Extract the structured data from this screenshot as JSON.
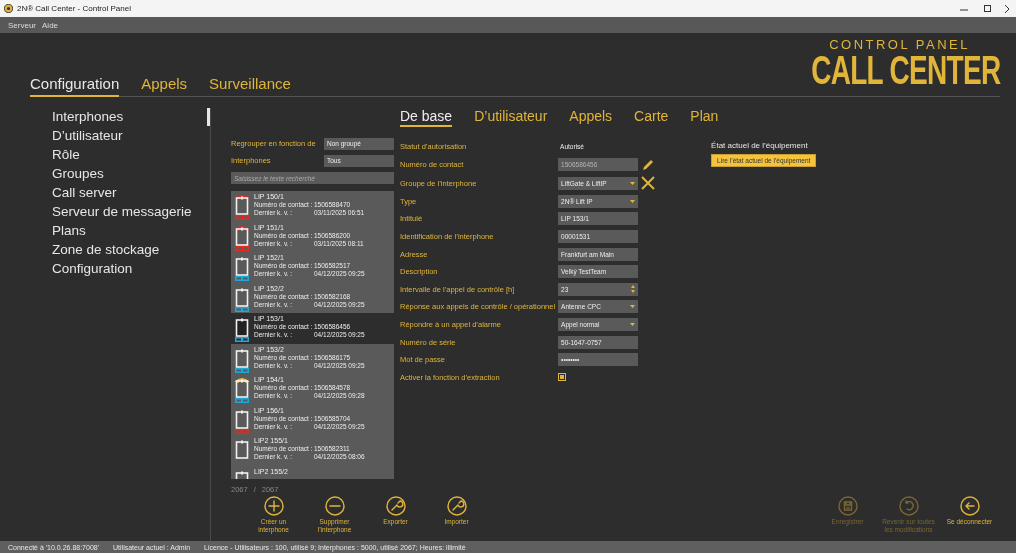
{
  "window": {
    "title": "2N® Call Center - Control Panel"
  },
  "menu": [
    "Serveur",
    "Aide"
  ],
  "logo": {
    "top": "CONTROL PANEL",
    "bottom": "CALL CENTER"
  },
  "main_tabs": [
    {
      "label": "Configuration",
      "selected": true
    },
    {
      "label": "Appels",
      "selected": false
    },
    {
      "label": "Surveillance",
      "selected": false
    }
  ],
  "sidebar": {
    "items": [
      {
        "label": "Interphones",
        "selected": true
      },
      {
        "label": "D’utilisateur",
        "selected": false
      },
      {
        "label": "Rôle",
        "selected": false
      },
      {
        "label": "Groupes",
        "selected": false
      },
      {
        "label": "Call server",
        "selected": false
      },
      {
        "label": "Serveur de messagerie",
        "selected": false
      },
      {
        "label": "Plans",
        "selected": false
      },
      {
        "label": "Zone de stockage",
        "selected": false
      },
      {
        "label": "Configuration",
        "selected": false
      }
    ]
  },
  "filters": [
    {
      "label": "Regrouper en fonction de",
      "value": "Non groupé"
    },
    {
      "label": "Interphones",
      "value": "Tous"
    }
  ],
  "search": {
    "placeholder": "Saisissez le texte recherché"
  },
  "intercoms": [
    {
      "name": "LIP 150/1",
      "contact_label": "Numéro de contact :",
      "contact": "1506588470",
      "last_label": "Dernier k. v. :",
      "last": "03/11/2025 06:51",
      "selected": false,
      "call": {
        "color": "#e8281e"
      },
      "link": {
        "color": "#e8281e"
      }
    },
    {
      "name": "LIP 151/1",
      "contact_label": "Numéro de contact :",
      "contact": "1506586200",
      "last_label": "Dernier k. v. :",
      "last": "03/11/2025 08:11",
      "selected": false,
      "call": {
        "color": "#e8281e"
      },
      "link": {
        "color": "#e8281e"
      }
    },
    {
      "name": "LIP 152/1",
      "contact_label": "Numéro de contact :",
      "contact": "1506582517",
      "last_label": "Dernier k. v. :",
      "last": "04/12/2025 09:25",
      "selected": false,
      "link": {
        "color": "#1ea8d8"
      }
    },
    {
      "name": "LIP 152/2",
      "contact_label": "Numéro de contact :",
      "contact": "1506582168",
      "last_label": "Dernier k. v. :",
      "last": "04/12/2025 09:25",
      "selected": false,
      "link": {
        "color": "#1ea8d8"
      }
    },
    {
      "name": "LIP 153/1",
      "contact_label": "Numéro de contact :",
      "contact": "1506586456",
      "last_label": "Dernier k. v. :",
      "last": "04/12/2025 09:25",
      "selected": true,
      "link": {
        "color": "#1ea8d8"
      }
    },
    {
      "name": "LIP 153/2",
      "contact_label": "Numéro de contact :",
      "contact": "1506586175",
      "last_label": "Dernier k. v. :",
      "last": "04/12/2025 09:25",
      "selected": false,
      "link": {
        "color": "#1ea8d8"
      }
    },
    {
      "name": "LIP 154/1",
      "contact_label": "Numéro de contact :",
      "contact": "1506584578",
      "last_label": "Dernier k. v. :",
      "last": "04/12/2025 09:28",
      "selected": false,
      "call": {
        "color": "#f0c030"
      },
      "link": {
        "color": "#1ea8d8"
      }
    },
    {
      "name": "LIP 156/1",
      "contact_label": "Numéro de contact :",
      "contact": "1506585704",
      "last_label": "Dernier k. v. :",
      "last": "04/12/2025 09:25",
      "selected": false,
      "link": {
        "color": "#e8281e"
      }
    },
    {
      "name": "LIP2 155/1",
      "contact_label": "Numéro de contact :",
      "contact": "1506582311",
      "last_label": "Dernier k. v. :",
      "last": "04/12/2025 08:06",
      "selected": false
    },
    {
      "name": "LIP2 155/2",
      "selected": false
    }
  ],
  "counter": {
    "shown": "2067",
    "separator": "/",
    "total": "2067"
  },
  "detail_tabs": [
    {
      "label": "De base",
      "selected": true
    },
    {
      "label": "D’utilisateur",
      "selected": false
    },
    {
      "label": "Appels",
      "selected": false
    },
    {
      "label": "Carte",
      "selected": false
    },
    {
      "label": "Plan",
      "selected": false
    }
  ],
  "form": [
    {
      "kind": "text",
      "label": "Statut d’autorisation",
      "value": "Autorisé"
    },
    {
      "kind": "locked",
      "label": "Numéro de contact",
      "value": "1506586456"
    },
    {
      "kind": "clearable",
      "label": "Groupe de l’interphone",
      "value": "LiftGate & LiftIP"
    },
    {
      "kind": "select",
      "label": "Type",
      "value": "2N® Lift IP"
    },
    {
      "kind": "input",
      "label": "Intitulé",
      "value": "LIP 153/1"
    },
    {
      "kind": "input",
      "label": "Identification de l’interphone",
      "value": "00001531"
    },
    {
      "kind": "input",
      "label": "Adresse",
      "value": "Frankfurt am Main"
    },
    {
      "kind": "input",
      "label": "Description",
      "value": "Velký TestTeam"
    },
    {
      "kind": "spinner",
      "label": "Intervalle de l’appel de contrôle [h]",
      "value": "23"
    },
    {
      "kind": "select",
      "label": "Réponse aux appels de contrôle / opérationnel",
      "value": "Antenne CPC"
    },
    {
      "kind": "select",
      "label": "Répondre à un appel d’alarme",
      "value": "Appel normal"
    },
    {
      "kind": "input",
      "label": "Numéro de série",
      "value": "50-1647-0757"
    },
    {
      "kind": "input",
      "label": "Mot de passe",
      "value": "••••••••"
    },
    {
      "kind": "checkbox",
      "label": "Activer la fonction d’extraction",
      "checked": true
    }
  ],
  "device_state": {
    "title": "État actuel de l’équipement",
    "button": "Lire l’état actuel de l’équipement"
  },
  "actions_left": [
    {
      "kind": "plus",
      "label": "Créer un interphone",
      "disabled": false
    },
    {
      "kind": "minus",
      "label": "Supprimer l’interphone",
      "disabled": false
    },
    {
      "kind": "wrench",
      "label": "Exporter",
      "disabled": false
    },
    {
      "kind": "wrench",
      "label": "Importer",
      "disabled": false
    }
  ],
  "actions_right": [
    {
      "kind": "save",
      "label": "Enregistrer",
      "disabled": true
    },
    {
      "kind": "undo",
      "label": "Revenir sur toutes les modifications",
      "disabled": true
    },
    {
      "kind": "back",
      "label": "Se déconnecter",
      "disabled": false
    }
  ],
  "status_bar": [
    "Connecté à '10.0.26.88:7008'",
    "Utilisateur actuel : Admin",
    "Licence - Utilisateurs : 100, utilisé 9;  Interphones : 5000, utilisé 2067;  Heures: illimité"
  ]
}
